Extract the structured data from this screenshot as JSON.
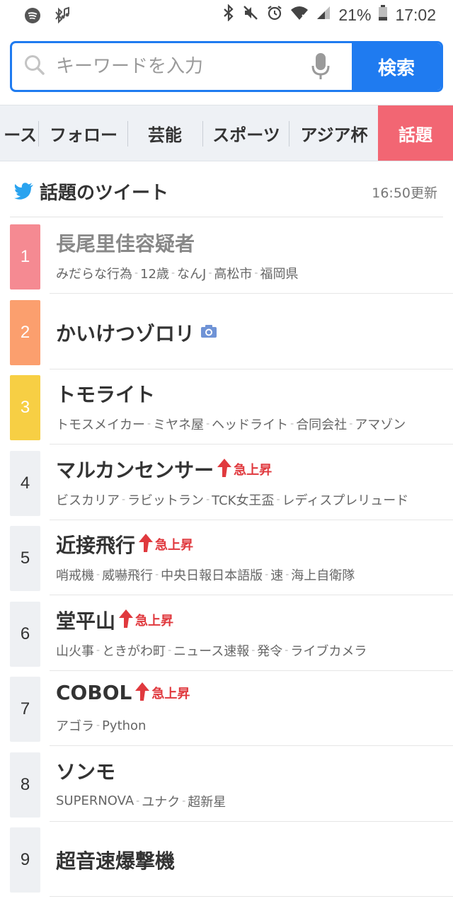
{
  "status_bar": {
    "battery_percent": "21%",
    "time": "17:02",
    "icons": [
      "spotify-icon",
      "bluetooth-music-icon",
      "bluetooth-icon",
      "mute-icon",
      "alarm-icon",
      "wifi-icon",
      "signal-icon",
      "battery-icon"
    ]
  },
  "search": {
    "placeholder": "キーワードを入力",
    "button_label": "検索"
  },
  "tabs": [
    {
      "label": "ース"
    },
    {
      "label": "フォロー"
    },
    {
      "label": "芸能"
    },
    {
      "label": "スポーツ"
    },
    {
      "label": "アジア杯"
    },
    {
      "label": "話題",
      "active": true
    }
  ],
  "section": {
    "title": "話題のツイート",
    "updated": "16:50更新"
  },
  "items": [
    {
      "rank": "1",
      "title": "長尾里佳容疑者",
      "tags": [
        "みだらな行為",
        "12歳",
        "なんJ",
        "高松市",
        "福岡県"
      ],
      "rank_color": "#f58a92"
    },
    {
      "rank": "2",
      "title": "かいけつゾロリ",
      "tags": [],
      "rank_color": "#fb9f6e",
      "camera": true
    },
    {
      "rank": "3",
      "title": "トモライト",
      "tags": [
        "トモスメイカー",
        "ミヤネ屋",
        "ヘッドライト",
        "合同会社",
        "アマゾン"
      ],
      "rank_color": "#f7cf44"
    },
    {
      "rank": "4",
      "title": "マルカンセンサー",
      "rise": "急上昇",
      "tags": [
        "ビスカリア",
        "ラビットラン",
        "TCK女王盃",
        "レディスプレリュード"
      ]
    },
    {
      "rank": "5",
      "title": "近接飛行",
      "rise": "急上昇",
      "tags": [
        "哨戒機",
        "威嚇飛行",
        "中央日報日本語版",
        "速",
        "海上自衛隊"
      ]
    },
    {
      "rank": "6",
      "title": "堂平山",
      "rise": "急上昇",
      "tags": [
        "山火事",
        "ときがわ町",
        "ニュース速報",
        "発令",
        "ライブカメラ"
      ]
    },
    {
      "rank": "7",
      "title": "COBOL",
      "rise": "急上昇",
      "tags": [
        "アゴラ",
        "Python"
      ]
    },
    {
      "rank": "8",
      "title": "ソンモ",
      "tags": [
        "SUPERNOVA",
        "ユナク",
        "超新星"
      ]
    },
    {
      "rank": "9",
      "title": "超音速爆撃機",
      "tags": []
    }
  ],
  "colors": {
    "accent": "#1f7bf0",
    "active_tab": "#f26673",
    "rise": "#e0393e"
  }
}
